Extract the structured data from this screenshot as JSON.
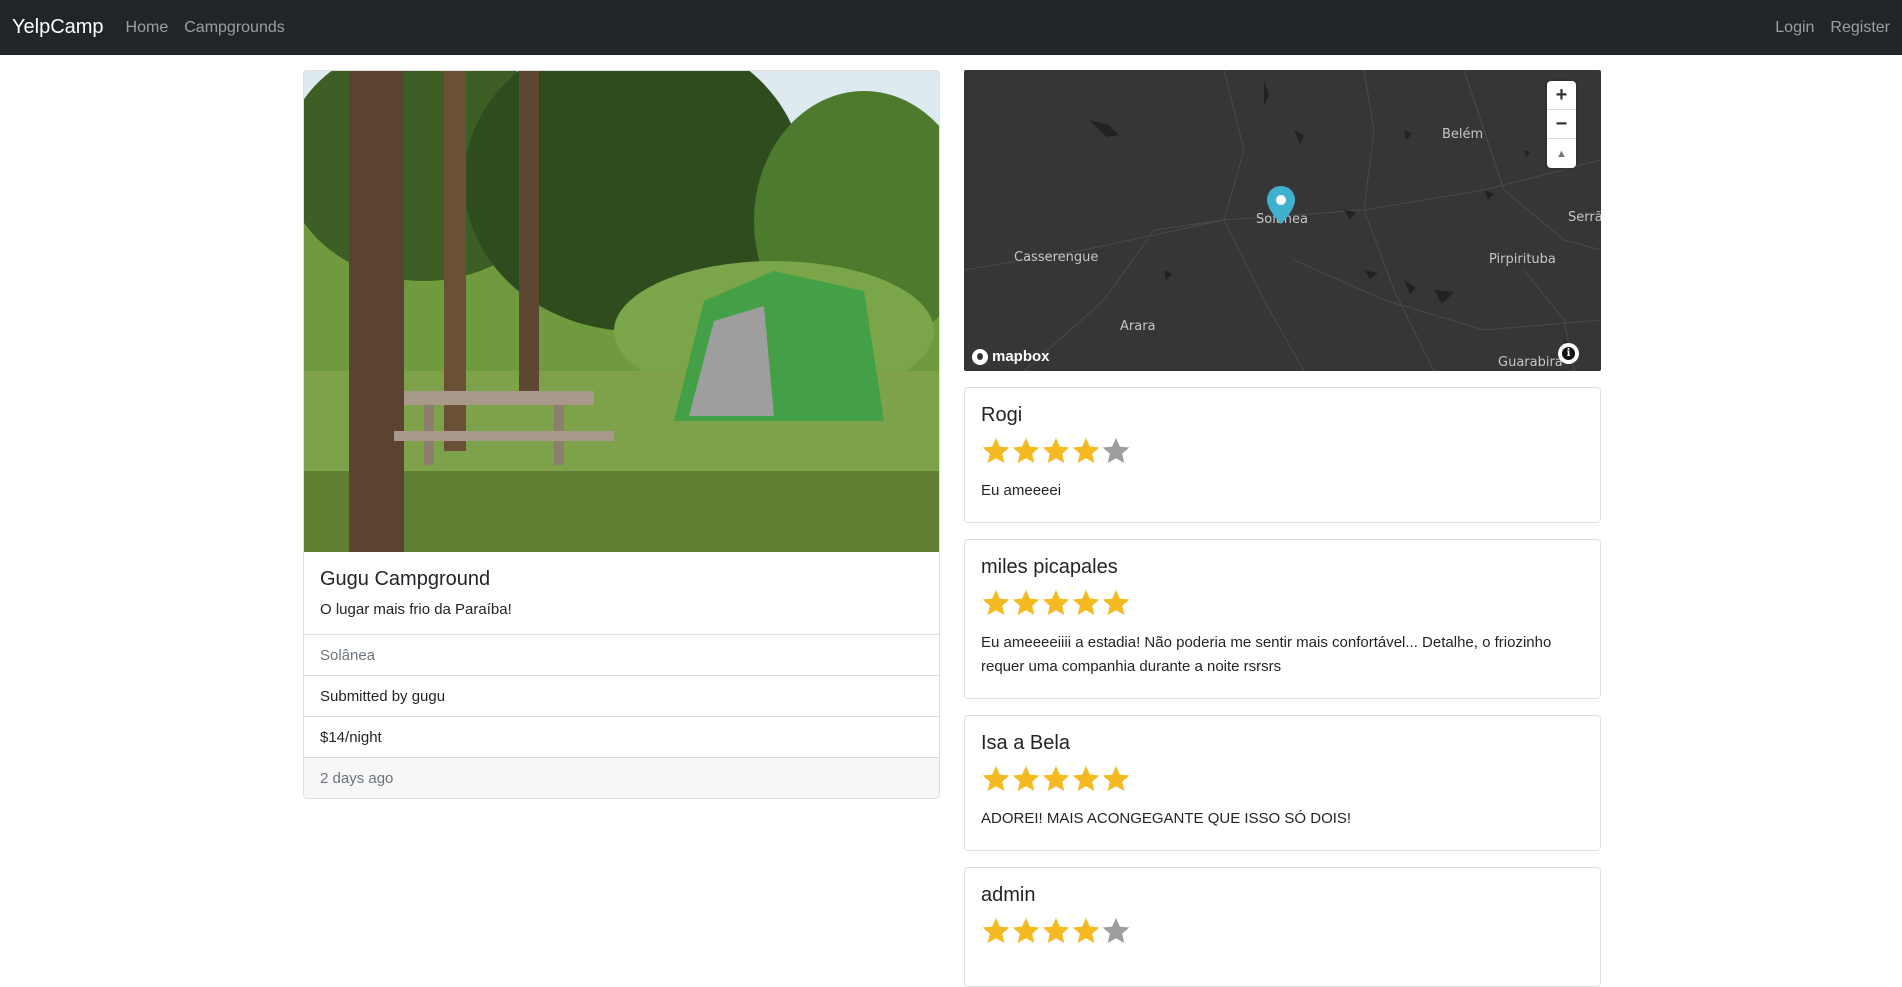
{
  "navbar": {
    "brand": "YelpCamp",
    "links": [
      "Home",
      "Campgrounds"
    ],
    "right_links": [
      "Login",
      "Register"
    ]
  },
  "campground": {
    "title": "Gugu Campground",
    "description": "O lugar mais frio da Paraíba!",
    "location": "Solânea",
    "submitted_by": "Submitted by gugu",
    "price": "$14/night",
    "posted": "2 days ago"
  },
  "map": {
    "labels": [
      "Belém",
      "Solânea",
      "Serrã",
      "Casserengue",
      "Pirpirituba",
      "Arara",
      "Guarabira"
    ],
    "attribution": "mapbox",
    "zoom_in": "+",
    "zoom_out": "−",
    "compass": "▲",
    "info": "i"
  },
  "reviews": [
    {
      "author": "Rogi",
      "rating": 4,
      "text": "Eu ameeeei"
    },
    {
      "author": "miles picapales",
      "rating": 5,
      "text": "Eu ameeeeiiii a estadia! Não poderia me sentir mais confortável... Detalhe, o friozinho requer uma companhia durante a noite rsrsrs"
    },
    {
      "author": "Isa a Bela",
      "rating": 5,
      "text": "ADOREI! MAIS ACONGEGANTE QUE ISSO SÓ DOIS!"
    },
    {
      "author": "admin",
      "rating": 4,
      "text": ""
    }
  ],
  "colors": {
    "star_filled": "#f5b922",
    "star_empty": "#9e9e9e",
    "navbar_bg": "#212529",
    "map_marker": "#3fb1ce"
  }
}
